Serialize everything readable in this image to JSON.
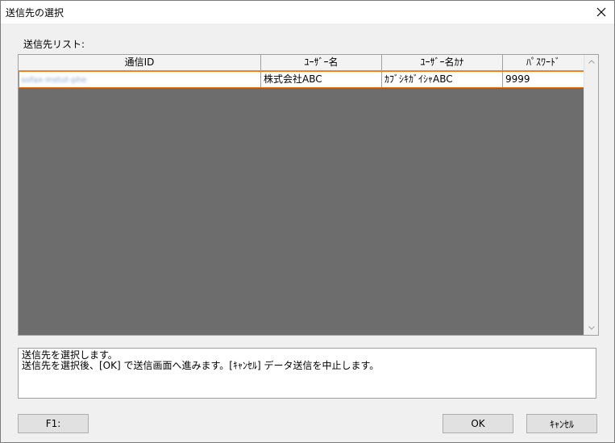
{
  "window": {
    "title": "送信先の選択"
  },
  "list": {
    "label": "送信先リスト:",
    "columns": [
      "通信ID",
      "ﾕｰｻﾞｰ名",
      "ﾕｰｻﾞｰ名ｶﾅ",
      "ﾊﾟｽﾜｰﾄﾞ"
    ],
    "rows": [
      {
        "id": "sofax-instut-phe",
        "user_name": "株式会社ABC",
        "user_name_kana": "ｶﾌﾞｼｷｶﾞｲｼｬABC",
        "password": "9999"
      }
    ]
  },
  "message": {
    "line1": "送信先を選択します。",
    "line2": "送信先を選択後、[OK] で送信画面へ進みます。[ｷｬﾝｾﾙ] データ送信を中止します。"
  },
  "buttons": {
    "f1": "F1:",
    "ok": "OK",
    "cancel": "ｷｬﾝｾﾙ"
  }
}
